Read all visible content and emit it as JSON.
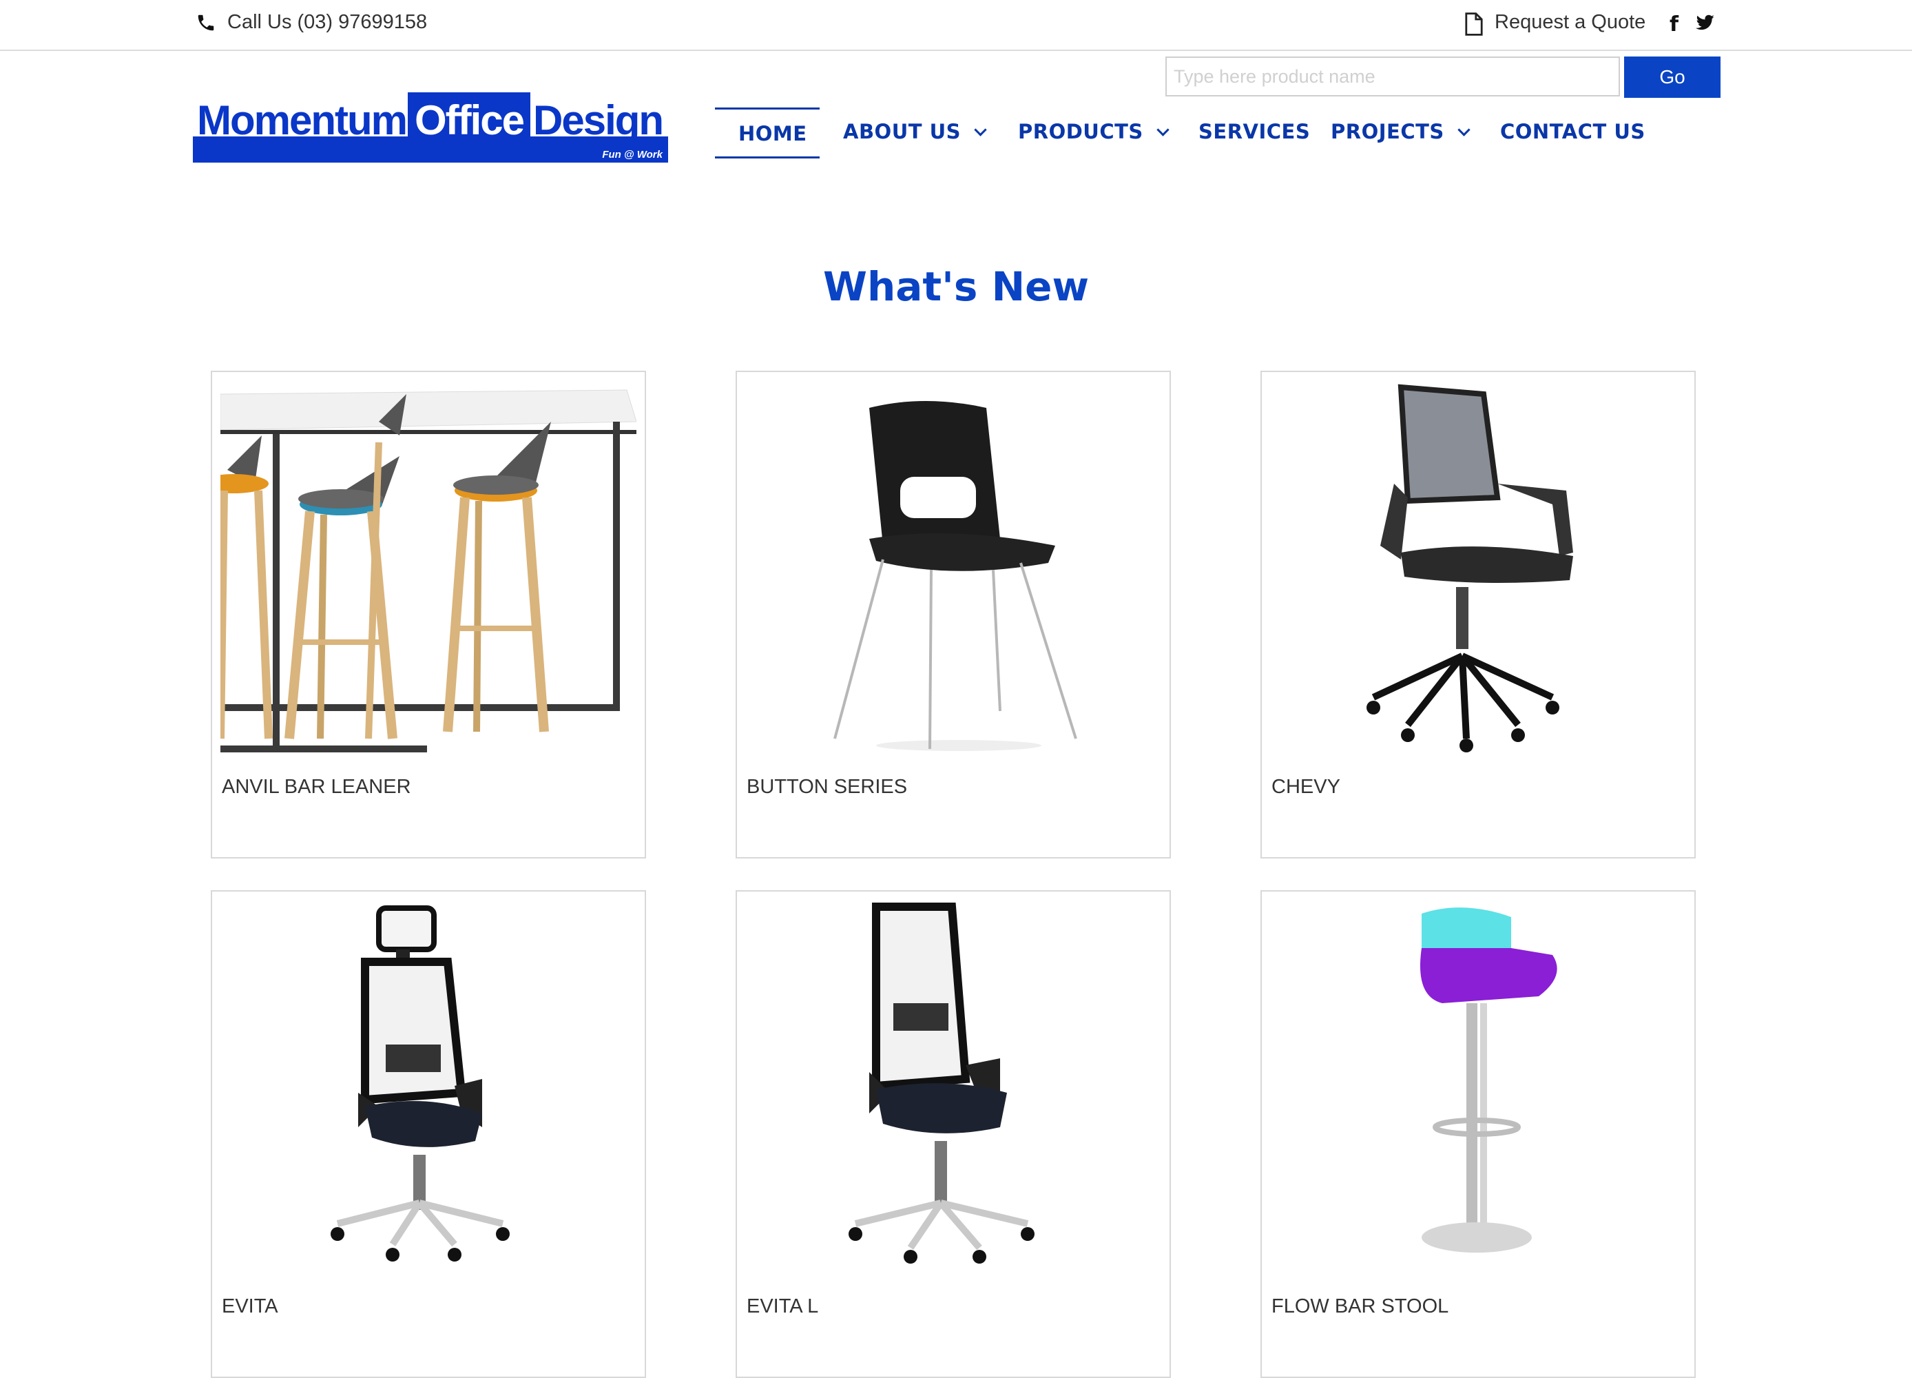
{
  "topbar": {
    "call_text": "Call Us (03) 97699158",
    "quote_text": "Request a Quote",
    "facebook_glyph": "f"
  },
  "search": {
    "placeholder": "Type here product name",
    "go_label": "Go"
  },
  "logo": {
    "word1": "Momentum",
    "word2": "Office",
    "word3": "Design",
    "tagline": "Fun @ Work"
  },
  "nav": {
    "home": "HOME",
    "about": "ABOUT US",
    "products": "PRODUCTS",
    "services": "SERVICES",
    "projects": "PROJECTS",
    "contact": "CONTACT US"
  },
  "section": {
    "title": "What's New"
  },
  "products": [
    {
      "name": "ANVIL BAR LEANER"
    },
    {
      "name": "BUTTON SERIES"
    },
    {
      "name": "CHEVY"
    },
    {
      "name": "EVITA"
    },
    {
      "name": "EVITA L"
    },
    {
      "name": "FLOW BAR STOOL"
    }
  ],
  "colors": {
    "brand_blue": "#0a37c8",
    "nav_blue": "#0a37a8",
    "button_blue": "#0a44c4"
  }
}
